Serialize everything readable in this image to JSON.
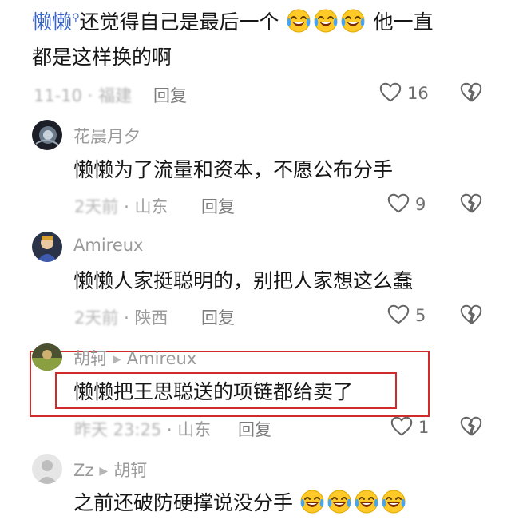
{
  "comments": [
    {
      "mention": "懒懒",
      "text_line1": "还觉得自己是最后一个",
      "text_after_emoji": "他一直",
      "text_line2": "都是这样换的啊",
      "date": "11-10",
      "location": "福建",
      "reply_label": "回复",
      "like_count": "16",
      "emoji_count": 3
    },
    {
      "username": "花晨月夕",
      "text": "懒懒为了流量和资本，不愿公布分手",
      "date": "2天前",
      "location": "山东",
      "reply_label": "回复",
      "like_count": "9"
    },
    {
      "username": "Amireux",
      "text": "懒懒人家挺聪明的，别把人家想这么蠢",
      "date": "2天前",
      "location": "陕西",
      "reply_label": "回复",
      "like_count": "5"
    },
    {
      "username": "胡轲",
      "reply_to": "Amireux",
      "text": "懒懒把王思聪送的项链都给卖了",
      "date": "昨天 23:25",
      "location": "山东",
      "reply_label": "回复",
      "like_count": "1",
      "highlight_color": "#d02a2a"
    },
    {
      "username": "Zz",
      "reply_to": "胡轲",
      "text": "之前还破防硬撑说没分手",
      "emoji_count": 4
    }
  ],
  "separator": "·",
  "icons": [
    "search-icon",
    "heart-icon",
    "broken-heart-icon",
    "laugh-cry-emoji",
    "reply-arrow-icon"
  ]
}
